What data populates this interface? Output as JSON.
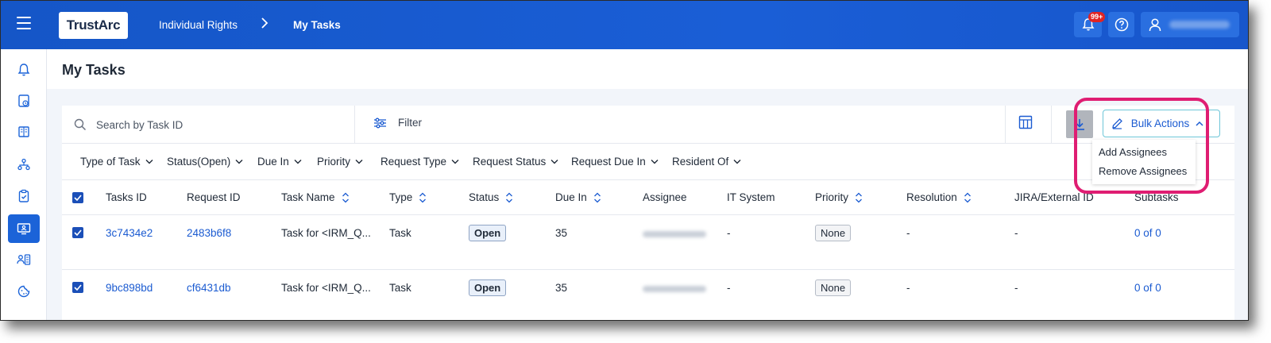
{
  "header": {
    "logo_text": "TrustArc",
    "breadcrumb": [
      "Individual Rights",
      "My Tasks"
    ],
    "notification_badge": "99+"
  },
  "page": {
    "title": "My Tasks"
  },
  "toolbar": {
    "search_placeholder": "Search by Task ID",
    "filter_label": "Filter",
    "bulk_actions_label": "Bulk Actions"
  },
  "bulk_menu": {
    "items": [
      "Add Assignees",
      "Remove Assignees"
    ]
  },
  "filters": [
    "Type of Task",
    "Status(Open)",
    "Due In",
    "Priority",
    "Request Type",
    "Request Status",
    "Request Due In",
    "Resident Of"
  ],
  "table": {
    "columns": [
      "Tasks ID",
      "Request ID",
      "Task Name",
      "Type",
      "Status",
      "Due In",
      "Assignee",
      "IT System",
      "Priority",
      "Resolution",
      "JIRA/External ID",
      "Subtasks"
    ],
    "rows": [
      {
        "task_id": "3c7434e2",
        "request_id": "2483b6f8",
        "task_name": "Task for <IRM_Q...",
        "type": "Task",
        "status": "Open",
        "due_in": "35",
        "it_system": "-",
        "priority": "None",
        "resolution": "-",
        "jira": "-",
        "subtasks": "0 of 0"
      },
      {
        "task_id": "9bc898bd",
        "request_id": "cf6431db",
        "task_name": "Task for <IRM_Q...",
        "type": "Task",
        "status": "Open",
        "due_in": "35",
        "it_system": "-",
        "priority": "None",
        "resolution": "-",
        "jira": "-",
        "subtasks": "0 of 0"
      }
    ]
  },
  "colors": {
    "header_blue": "#1a5ed6",
    "accent_link": "#1b5bd1",
    "highlight_ring": "#df1d72"
  }
}
